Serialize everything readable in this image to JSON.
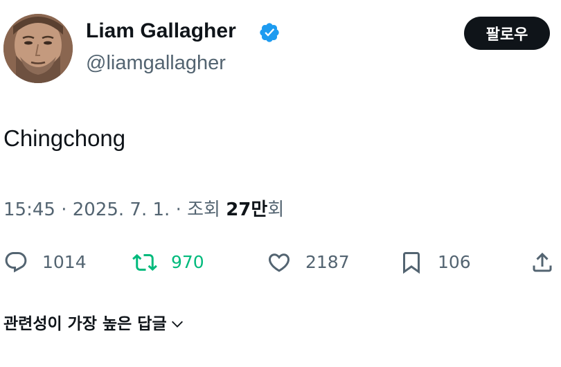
{
  "author": {
    "name": "Liam Gallagher",
    "handle": "@liamgallagher",
    "verified_icon": "verified-badge-icon",
    "verified_color": "#1d9bf0"
  },
  "follow_button": {
    "label": "팔로우"
  },
  "tweet": {
    "text": "Chingchong"
  },
  "meta": {
    "time": "15:45",
    "separator": "·",
    "date": "2025. 7. 1.",
    "views_label": "조회",
    "views_number": "27만",
    "views_suffix": "회"
  },
  "actions": {
    "reply": {
      "icon": "reply-icon",
      "count": "1014"
    },
    "retweet": {
      "icon": "retweet-icon",
      "count": "970",
      "color": "#00ba7c"
    },
    "like": {
      "icon": "heart-icon",
      "count": "2187"
    },
    "bookmark": {
      "icon": "bookmark-icon",
      "count": "106"
    },
    "share": {
      "icon": "share-icon"
    }
  },
  "replies_sort": {
    "label": "관련성이 가장 높은 답글",
    "icon": "chevron-down-icon"
  }
}
